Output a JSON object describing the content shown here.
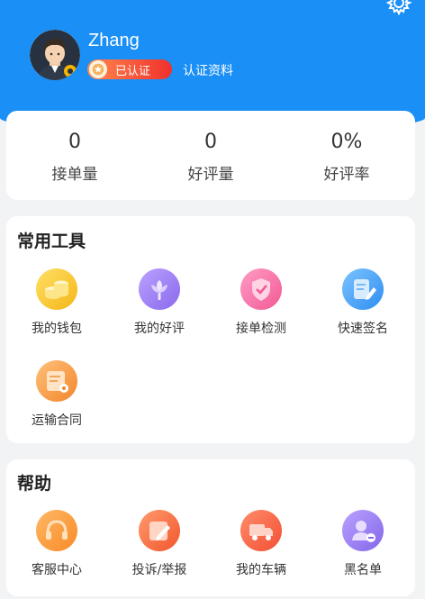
{
  "profile": {
    "name": "Zhang",
    "verified_badge": "已认证",
    "cert_link": "认证资料"
  },
  "stats": [
    {
      "value": "0",
      "label": "接单量"
    },
    {
      "value": "0",
      "label": "好评量"
    },
    {
      "value": "0%",
      "label": "好评率"
    }
  ],
  "tools": {
    "title": "常用工具",
    "items": [
      {
        "label": "我的钱包",
        "icon": "coins-icon",
        "color": "#f7c52d"
      },
      {
        "label": "我的好评",
        "icon": "flower-icon",
        "color": "#9a7cf2"
      },
      {
        "label": "接单检测",
        "icon": "shield-check-icon",
        "color": "#f56fa3"
      },
      {
        "label": "快速签名",
        "icon": "sign-pen-icon",
        "color": "#3e9ef5"
      },
      {
        "label": "运输合同",
        "icon": "contract-icon",
        "color": "#f7a04a"
      }
    ]
  },
  "help": {
    "title": "帮助",
    "items": [
      {
        "label": "客服中心",
        "icon": "headset-icon",
        "color": "#fb9a3c"
      },
      {
        "label": "投诉/举报",
        "icon": "edit-icon",
        "color": "#f66a3c"
      },
      {
        "label": "我的车辆",
        "icon": "truck-icon",
        "color": "#f5653f"
      },
      {
        "label": "黑名单",
        "icon": "user-block-icon",
        "color": "#9a7cf2"
      }
    ]
  },
  "colors": {
    "header": "#1a8ff5",
    "badge_start": "#ff8a4d",
    "badge_end": "#f0302d",
    "background": "#f2f3f5"
  }
}
